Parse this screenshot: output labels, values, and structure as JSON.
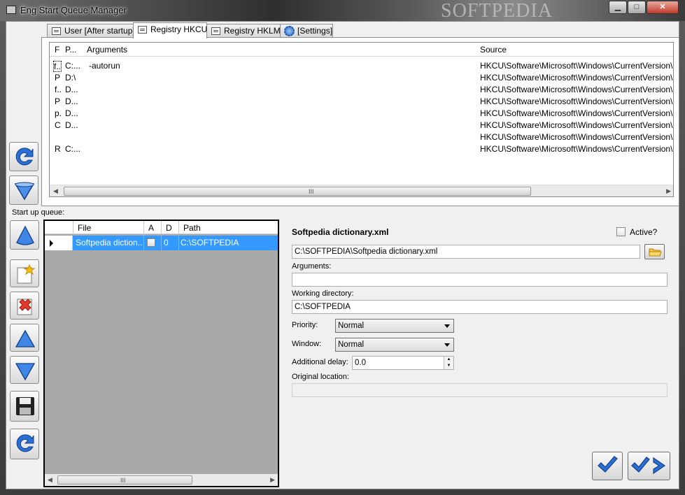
{
  "window": {
    "title": "Eng Start Queue Manager",
    "watermark": "SOFTPEDIA",
    "minimize": "▁",
    "maximize": "□",
    "close": "✕"
  },
  "tabs": [
    {
      "label": "User [After startup]"
    },
    {
      "label": "Registry HKCU"
    },
    {
      "label": "Registry HKLM"
    },
    {
      "label": "[Settings]"
    }
  ],
  "registry_grid": {
    "columns": [
      "F",
      "P...",
      "Arguments",
      "Source"
    ],
    "rows": [
      {
        "f": "f...",
        "p": "C:...",
        "args": "-autorun",
        "source": "HKCU\\Software\\Microsoft\\Windows\\CurrentVersion\\Run\\"
      },
      {
        "f": "P",
        "p": "D:\\",
        "args": "",
        "source": "HKCU\\Software\\Microsoft\\Windows\\CurrentVersion\\Run\\"
      },
      {
        "f": "f...",
        "p": "D...",
        "args": "",
        "source": "HKCU\\Software\\Microsoft\\Windows\\CurrentVersion\\Run\\"
      },
      {
        "f": "P",
        "p": "D...",
        "args": "",
        "source": "HKCU\\Software\\Microsoft\\Windows\\CurrentVersion\\Run\\"
      },
      {
        "f": "p.",
        "p": "D...",
        "args": "",
        "source": "HKCU\\Software\\Microsoft\\Windows\\CurrentVersion\\Run\\"
      },
      {
        "f": "C",
        "p": "D...",
        "args": "",
        "source": "HKCU\\Software\\Microsoft\\Windows\\CurrentVersion\\Run\\"
      },
      {
        "f": "",
        "p": "",
        "args": "",
        "source": "HKCU\\Software\\Microsoft\\Windows\\CurrentVersion\\Run\\"
      },
      {
        "f": "R",
        "p": "C:...",
        "args": "",
        "source": "HKCU\\Software\\Microsoft\\Windows\\CurrentVersion\\Run\\"
      }
    ],
    "scroll_grip": "III"
  },
  "queue": {
    "label": "Start up queue:",
    "columns": [
      "File",
      "A",
      "D",
      "Path"
    ],
    "rows": [
      {
        "file": "Softpedia diction...",
        "a": false,
        "d": "0",
        "path": "C:\\SOFTPEDIA"
      }
    ],
    "scroll_grip": "III"
  },
  "details": {
    "title": "Softpedia dictionary.xml",
    "active_label": "Active?",
    "active_checked": false,
    "file_path": "C:\\SOFTPEDIA\\Softpedia dictionary.xml",
    "arguments_label": "Arguments:",
    "arguments_value": "",
    "working_dir_label": "Working directory:",
    "working_dir_value": "C:\\SOFTPEDIA",
    "priority_label": "Priority:",
    "priority_value": "Normal",
    "window_label": "Window:",
    "window_value": "Normal",
    "delay_label": "Additional delay:",
    "delay_value": "0.0",
    "original_location_label": "Original location:",
    "original_location_value": ""
  },
  "colors": {
    "selection": "#3399ff",
    "button_blue": "#2b6fd6"
  }
}
